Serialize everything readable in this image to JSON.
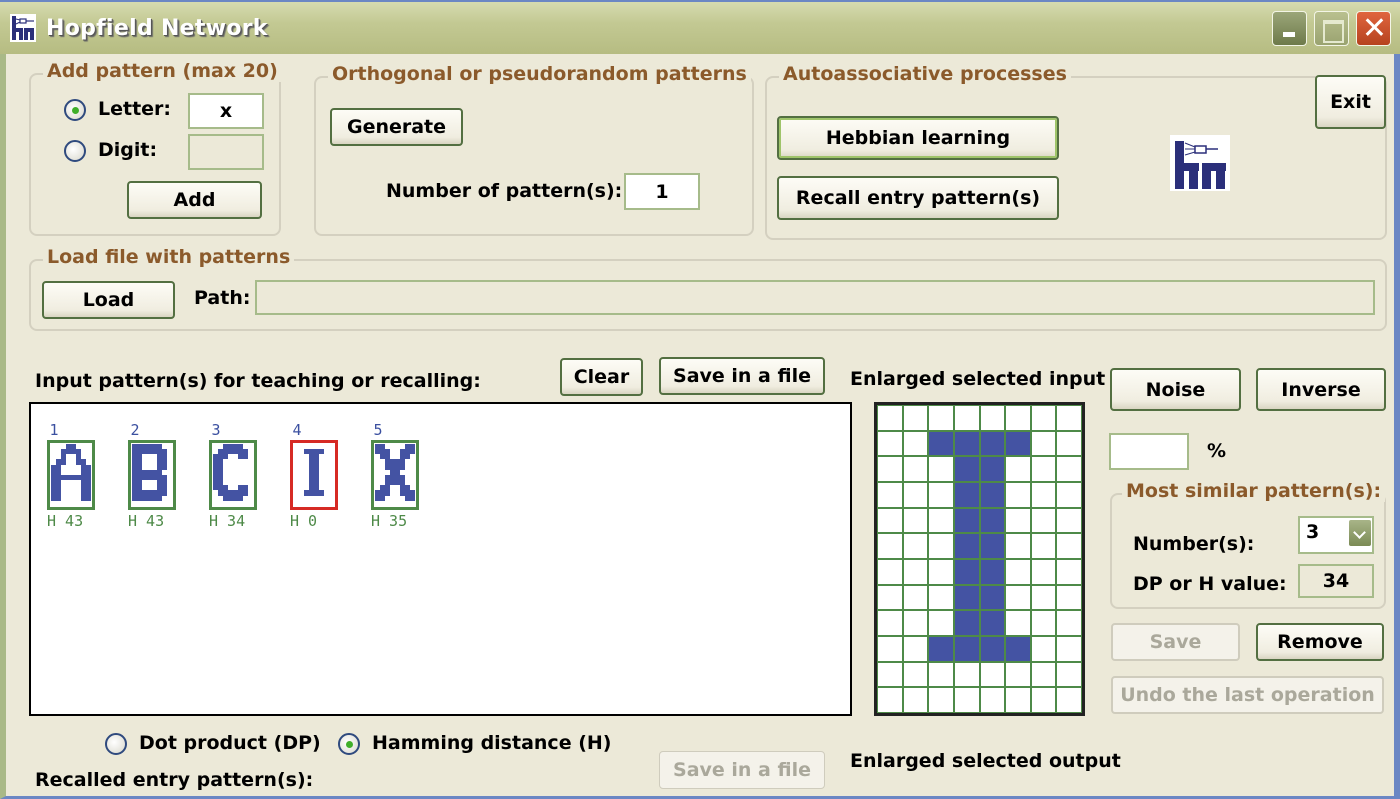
{
  "window": {
    "title": "Hopfield Network",
    "controls": [
      "minimize",
      "maximize",
      "close"
    ],
    "close_glyph": "✕"
  },
  "add_pattern": {
    "legend": "Add pattern (max 20)",
    "letter_label": "Letter:",
    "letter_value": "x",
    "letter_checked": true,
    "digit_label": "Digit:",
    "digit_value": "",
    "digit_checked": false,
    "add_button": "Add"
  },
  "orthogonal": {
    "legend": "Orthogonal or pseudorandom patterns",
    "generate_button": "Generate",
    "count_label": "Number of pattern(s):",
    "count_value": "1"
  },
  "autoassociative": {
    "legend": "Autoassociative processes",
    "hebbian_button": "Hebbian learning",
    "recall_button": "Recall entry pattern(s)"
  },
  "exit_button": "Exit",
  "load_file": {
    "legend": "Load file with patterns",
    "load_button": "Load",
    "path_label": "Path:",
    "path_value": ""
  },
  "input_patterns": {
    "label": "Input pattern(s) for teaching or recalling:",
    "clear_button": "Clear",
    "save_button": "Save in a file",
    "selected_index": 3,
    "items": [
      {
        "num": "1",
        "letter": "A",
        "h": "H 43",
        "bitmap": [
          "00011000",
          "00111100",
          "00100100",
          "01100110",
          "11000011",
          "11000011",
          "11111111",
          "11000011",
          "11000011",
          "11000011",
          "11000011",
          "00000000"
        ]
      },
      {
        "num": "2",
        "letter": "B",
        "h": "H 43",
        "bitmap": [
          "11111100",
          "11111110",
          "11000110",
          "11000110",
          "11000110",
          "11111100",
          "11111110",
          "11000110",
          "11000110",
          "11111110",
          "11111100",
          "00000000"
        ]
      },
      {
        "num": "3",
        "letter": "C",
        "h": "H 34",
        "bitmap": [
          "00111100",
          "01111110",
          "11100110",
          "11000000",
          "11000000",
          "11000000",
          "11000000",
          "11000000",
          "11100110",
          "01111110",
          "00111100",
          "00000000"
        ]
      },
      {
        "num": "4",
        "letter": "I",
        "h": "H 0",
        "bitmap": [
          "00000000",
          "00111100",
          "00011000",
          "00011000",
          "00011000",
          "00011000",
          "00011000",
          "00011000",
          "00011000",
          "00111100",
          "00000000",
          "00000000"
        ]
      },
      {
        "num": "5",
        "letter": "X",
        "h": "H 35",
        "bitmap": [
          "11000011",
          "11100111",
          "01100110",
          "00111100",
          "00111100",
          "00011000",
          "00111100",
          "00111100",
          "01100110",
          "11100111",
          "11000011",
          "00000000"
        ]
      }
    ]
  },
  "metric": {
    "dp_label": "Dot product (DP)",
    "dp_checked": false,
    "h_label": "Hamming distance (H)",
    "h_checked": true
  },
  "recalled": {
    "label": "Recalled entry pattern(s):",
    "save_button": "Save in a file"
  },
  "enlarged_input": {
    "label": "Enlarged selected input",
    "bitmap": [
      "00000000",
      "00111100",
      "00011000",
      "00011000",
      "00011000",
      "00011000",
      "00011000",
      "00011000",
      "00011000",
      "00111100",
      "00000000",
      "00000000"
    ]
  },
  "enlarged_output": {
    "label": "Enlarged selected output"
  },
  "tools": {
    "noise_button": "Noise",
    "inverse_button": "Inverse",
    "noise_percent_value": "",
    "percent_label": "%"
  },
  "most_similar": {
    "legend": "Most similar pattern(s):",
    "numbers_label": "Number(s):",
    "numbers_value": "3",
    "value_label": "DP or H value:",
    "value": "34"
  },
  "actions": {
    "save_button": "Save",
    "remove_button": "Remove",
    "undo_button": "Undo the last operation"
  },
  "colors": {
    "legend_brown": "#8b5a2b",
    "pixel_on": "#4453a3",
    "grid_green": "#4e8a48",
    "selected_red": "#d62a24",
    "window_bg": "#ece9d8"
  }
}
